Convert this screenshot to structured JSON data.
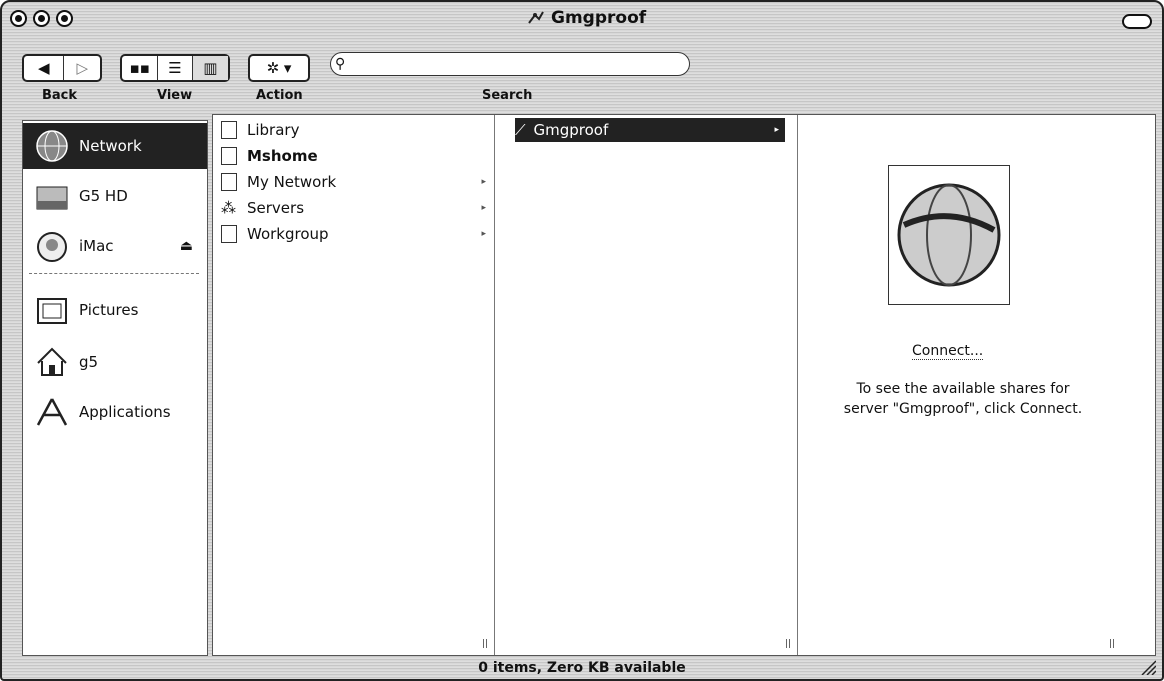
{
  "window": {
    "title": "Gmgproof"
  },
  "toolbar": {
    "back_label": "Back",
    "view_label": "View",
    "action_label": "Action",
    "search_label": "Search",
    "search_placeholder": ""
  },
  "sidebar": {
    "items": [
      {
        "label": "Network",
        "icon": "network-globe-icon",
        "selected": true
      },
      {
        "label": "G5 HD",
        "icon": "hard-drive-icon"
      },
      {
        "label": "iMac",
        "icon": "imac-icon",
        "eject": true
      },
      {
        "label": "Pictures",
        "icon": "pictures-folder-icon"
      },
      {
        "label": "g5",
        "icon": "home-icon"
      },
      {
        "label": "Applications",
        "icon": "applications-icon"
      }
    ]
  },
  "columns": {
    "col1": [
      "Library",
      "Mshome",
      "My Network",
      "Servers",
      "Workgroup"
    ],
    "col2": [
      "Gmgproof"
    ]
  },
  "preview": {
    "connect_label": "Connect...",
    "info_line1": "To see the available shares for",
    "info_line2": "server \"Gmgproof\", click Connect."
  },
  "status": {
    "text": "0 items, Zero KB available"
  }
}
